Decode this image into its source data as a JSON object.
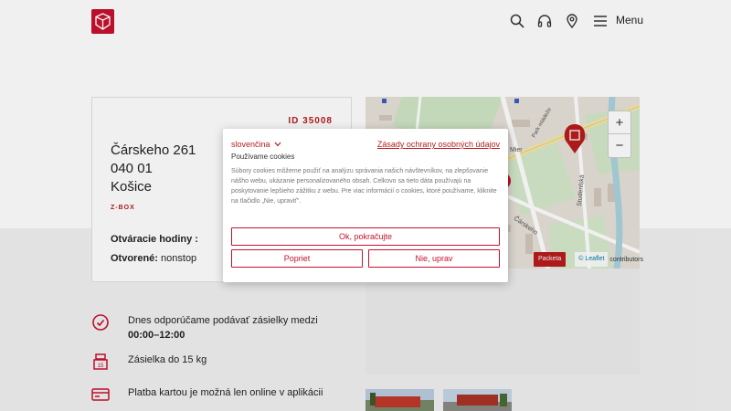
{
  "header": {
    "menu_label": "Menu",
    "icons": [
      "search-icon",
      "headphones-icon",
      "location-pin-icon",
      "hamburger-icon"
    ]
  },
  "place": {
    "id": "ID 35008",
    "street": "Čárskeho 261",
    "zip": "040 01",
    "city": "Košice",
    "type": "Z-BOX",
    "hours_title": "Otváracie hodiny :",
    "open_label": "Otvorené:",
    "open_value": "nonstop"
  },
  "map": {
    "zoom_in": "+",
    "zoom_out": "−",
    "attribution_brand": "Packeta",
    "attribution_leaflet": "© Leaflet",
    "attribution_contrib": "contributors",
    "labels": [
      "Mier",
      "Čárskeho",
      "Studenlská",
      "Park mládeže"
    ]
  },
  "features": [
    {
      "icon": "clock-icon",
      "text": "Dnes odporúčame podávať zásielky medzi ",
      "bold": "00:00–12:00"
    },
    {
      "icon": "weight-icon",
      "text": "Zásielka do 15 kg",
      "bold": ""
    },
    {
      "icon": "card-payment-icon",
      "text": "Platba kartou je možná len online v aplikácii",
      "bold": ""
    }
  ],
  "cookie": {
    "language": "slovenčina",
    "policy_link": "Zásady ochrany osobných údajov",
    "title": "Používame cookies",
    "body": "Súbory cookies môžeme použiť na analýzu správania našich návštevníkov, na zlepšovanie nášho webu, ukázanie personalizovaného obsah. Celkovo sa tieto dáta používajú na poskytovanie lepšieho zážitku z webu. Pre viac informácií o cookies, ktoré používame, kliknite na tlačidlo „Nie, upraviť\".",
    "accept_button": "Ok, pokračujte",
    "policy_button": "Popriet",
    "reject_button": "Nie, uprav"
  },
  "colors": {
    "brand": "#c8102e",
    "brand_dark": "#b71c1c"
  }
}
